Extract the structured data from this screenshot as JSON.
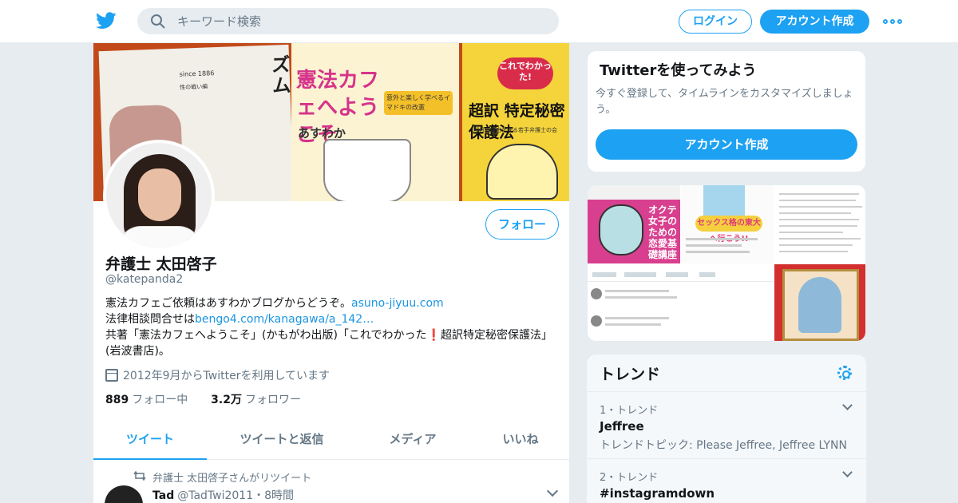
{
  "header": {
    "search_placeholder": "キーワード検索",
    "login_label": "ログイン",
    "signup_label": "アカウント作成"
  },
  "colors": {
    "accent": "#1da1f2",
    "link": "#1b95e0",
    "background": "#e6ecf0"
  },
  "banner": {
    "book1_small1": "since 1886",
    "book1_small2": "性の戦い編",
    "book1_title": "日本のフェミニズム",
    "book2_title": "憲法カフェへようこそ",
    "book2_sub": "意外と楽しく学べるイマドキの改憲",
    "book2_author": "あすわか",
    "book3_badge": "これでわかった!",
    "book3_title": "超訳 特定秘密保護法",
    "book3_sub": "明日の自由を守る若手弁護士の会"
  },
  "profile": {
    "follow_label": "フォロー",
    "name": "弁護士 太田啓子",
    "handle": "@katepanda2",
    "bio_line1_text": "憲法カフェご依頼はあすわかブログからどうぞ。",
    "bio_line1_link": "asuno-jiyuu.com",
    "bio_line2_text": "法律相談問合せは",
    "bio_line2_link": "bengo4.com/kanagawa/a_142…",
    "bio_line3_a": "共著「憲法カフェへようこそ」(かもがわ出版)「これでわかった",
    "bio_line3_mark": "❗",
    "bio_line3_b": "超訳特定秘密保護法」(岩波書店)。",
    "joined": "2012年9月からTwitterを利用しています",
    "following_count": "889",
    "following_label": "フォロー中",
    "followers_count": "3.2万",
    "followers_label": "フォロワー"
  },
  "tabs": [
    {
      "label": "ツイート",
      "active": true
    },
    {
      "label": "ツイートと返信",
      "active": false
    },
    {
      "label": "メディア",
      "active": false
    },
    {
      "label": "いいね",
      "active": false
    }
  ],
  "tweet": {
    "retweet_note": "弁護士 太田啓子さんがリツイート",
    "author_name": "Tad",
    "author_handle": "@TadTwi2011",
    "time": "・8時間"
  },
  "signup_card": {
    "title": "Twitterを使ってみよう",
    "text": "今すぐ登録して、タイムラインをカスタマイズしましょう。",
    "button": "アカウント作成"
  },
  "media": {
    "m1_text": "オクテ女子のための恋愛基礎講座",
    "m2_text": "セックス格の東大へ行こう!!"
  },
  "trends": {
    "title": "トレンド",
    "items": [
      {
        "meta": "1・トレンド",
        "topic": "Jeffree",
        "desc": "トレンドトピック: Please Jeffree, Jeffree LYNN"
      },
      {
        "meta": "2・トレンド",
        "topic": "#instagramdown",
        "desc": ""
      }
    ]
  }
}
